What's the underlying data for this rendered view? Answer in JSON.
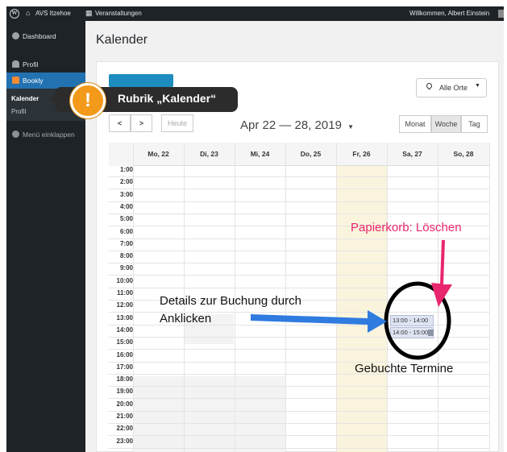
{
  "adminbar": {
    "site_name": "AVS Itzehoe",
    "events_label": "Veranstaltungen",
    "welcome": "Willkommen, Albert Einstein"
  },
  "sidebar": {
    "items": [
      {
        "label": "Dashboard",
        "icon": "dashboard-icon"
      },
      {
        "label": "Profil",
        "icon": "user-icon"
      },
      {
        "label": "Bookly",
        "icon": "bookly-icon"
      }
    ],
    "sub_items": [
      "Kalender",
      "Profil"
    ],
    "collapse_label": "Menü einklappen"
  },
  "page": {
    "title": "Kalender"
  },
  "toolbar": {
    "location_select": "Alle Orte",
    "today": "Heute",
    "prev": "<",
    "next": ">",
    "range": "Apr 22 — 28, 2019",
    "views": [
      "Monat",
      "Woche",
      "Tag"
    ],
    "active_view": "Woche"
  },
  "calendar": {
    "days": [
      "Mo, 22",
      "Di, 23",
      "Mi, 24",
      "Do, 25",
      "Fr, 26",
      "Sa, 27",
      "So, 28"
    ],
    "hours": [
      "1:00",
      "2:00",
      "3:00",
      "4:00",
      "5:00",
      "6:00",
      "7:00",
      "8:00",
      "9:00",
      "10:00",
      "11:00",
      "12:00",
      "13:00",
      "14:00",
      "15:00",
      "16:00",
      "17:00",
      "18:00",
      "19:00",
      "20:00",
      "21:00",
      "22:00",
      "23:00"
    ],
    "events": [
      {
        "label": "13:00 - 14:00"
      },
      {
        "label": "14:00 - 15:00"
      }
    ]
  },
  "annotations": {
    "callout": "Rubrik „Kalender“",
    "callout_mark": "!",
    "trash": "Papierkorb: Löschen",
    "details_line1": "Details zur Buchung durch",
    "details_line2": "Anklicken",
    "booked": "Gebuchte Termine",
    "colors": {
      "pink": "#e8266e",
      "blue": "#2f7be0",
      "orange": "#f39a1b"
    }
  }
}
